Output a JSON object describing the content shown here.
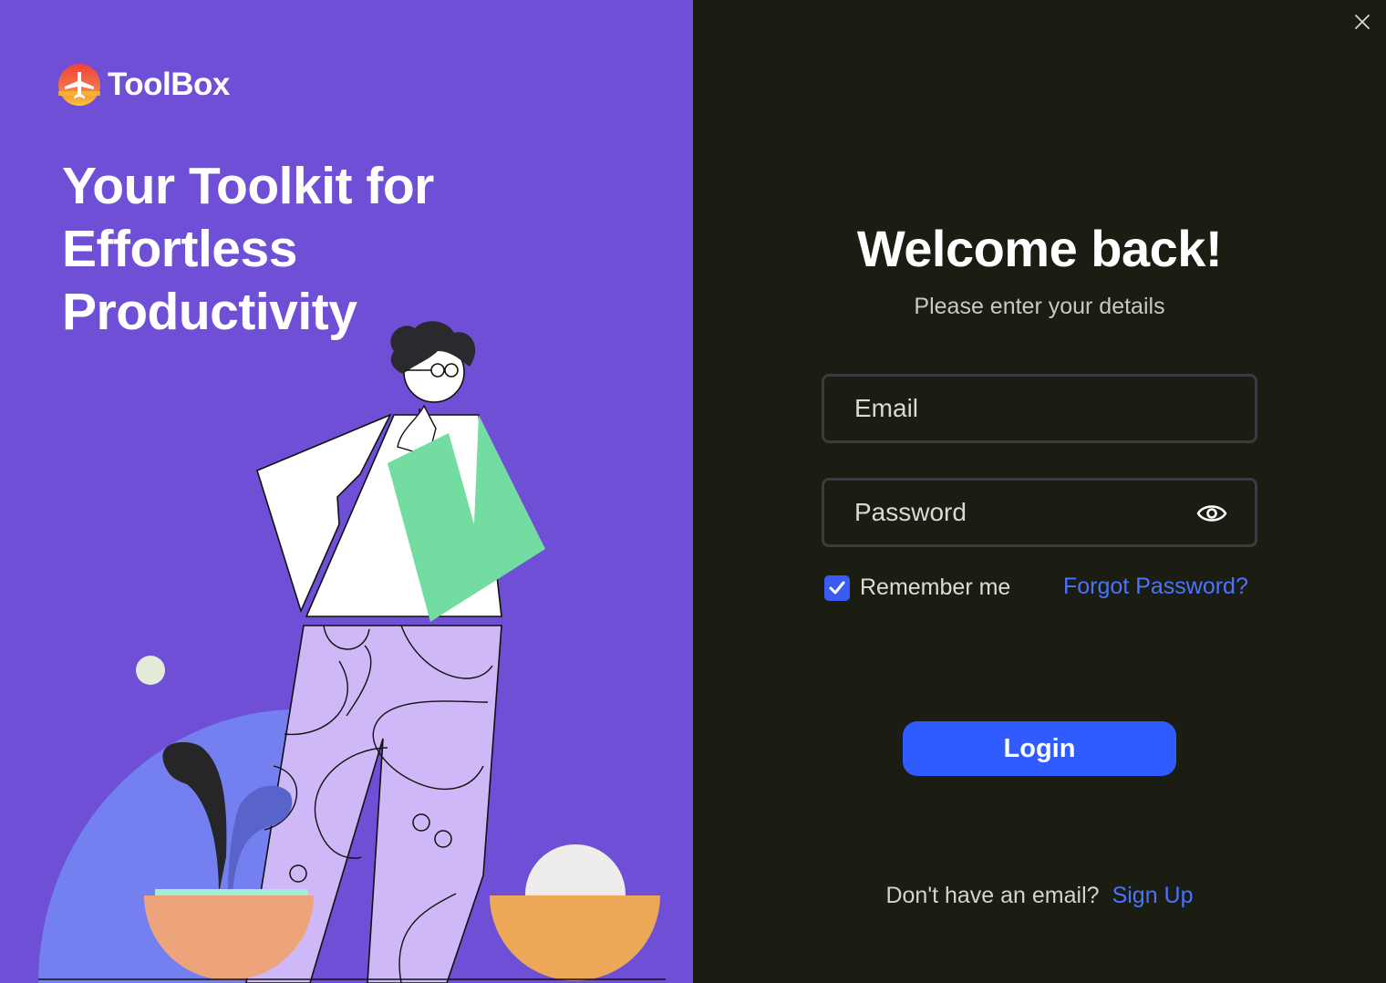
{
  "brand": {
    "name": "ToolBox",
    "logo_icon": "airplane-logo-icon"
  },
  "hero": {
    "lines": [
      "Your Toolkit for",
      "Effortless",
      "Productivity"
    ]
  },
  "window": {
    "close_icon": "close-icon"
  },
  "login": {
    "title": "Welcome back!",
    "subtitle": "Please enter your details",
    "email_placeholder": "Email",
    "password_placeholder": "Password",
    "password_toggle_icon": "eye-icon",
    "remember_label": "Remember me",
    "remember_checked": true,
    "forgot_label": "Forgot Password?",
    "submit_label": "Login",
    "signup_prompt": "Don't have an email?",
    "signup_link": "Sign Up"
  },
  "colors": {
    "left_panel": "#6e4fd6",
    "right_panel": "#1c1d12",
    "accent": "#2f5bff",
    "link": "#4a73ff"
  }
}
